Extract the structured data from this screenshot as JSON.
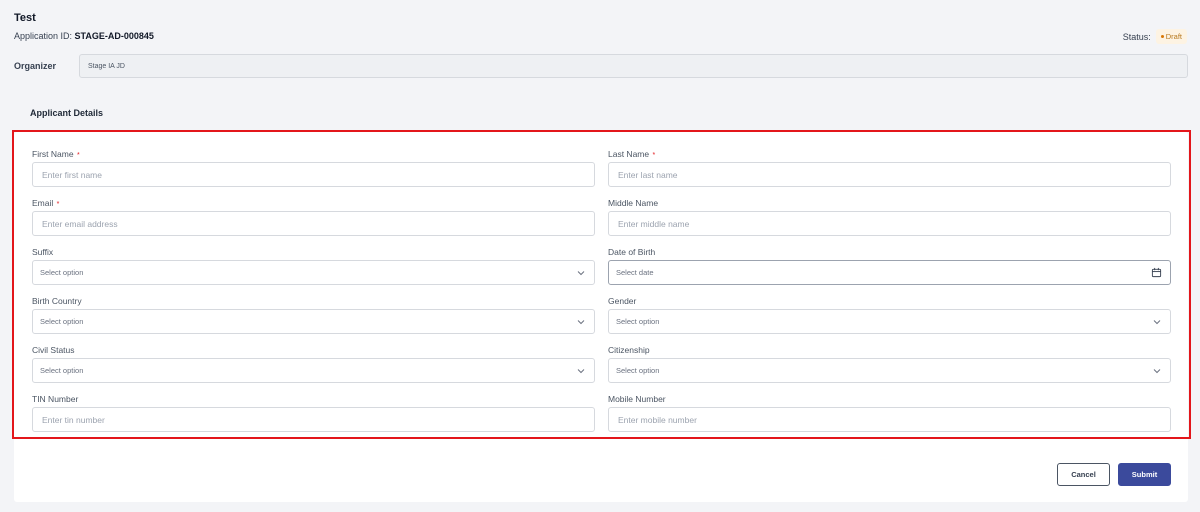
{
  "header": {
    "title": "Test",
    "app_id_label": "Application ID:",
    "app_id_value": "STAGE-AD-000845",
    "status_label": "Status:",
    "status_value": "Draft",
    "status_color": "#d97706"
  },
  "organizer": {
    "label": "Organizer",
    "value": "Stage IA JD"
  },
  "tab": {
    "label": "Applicant Details"
  },
  "form": {
    "first_name": {
      "label": "First Name",
      "required": "*",
      "placeholder": "Enter first name"
    },
    "last_name": {
      "label": "Last Name",
      "required": "*",
      "placeholder": "Enter last name"
    },
    "email": {
      "label": "Email",
      "required": "*",
      "placeholder": "Enter email address"
    },
    "middle_name": {
      "label": "Middle Name",
      "placeholder": "Enter middle name"
    },
    "suffix": {
      "label": "Suffix",
      "value": "Select option"
    },
    "dob": {
      "label": "Date of Birth",
      "value": "Select date"
    },
    "birth_country": {
      "label": "Birth Country",
      "value": "Select option"
    },
    "gender": {
      "label": "Gender",
      "value": "Select option"
    },
    "civil_status": {
      "label": "Civil Status",
      "value": "Select option"
    },
    "citizenship": {
      "label": "Citizenship",
      "value": "Select option"
    },
    "tin": {
      "label": "TIN Number",
      "placeholder": "Enter tin number"
    },
    "mobile": {
      "label": "Mobile Number",
      "placeholder": "Enter mobile number"
    }
  },
  "actions": {
    "cancel": "Cancel",
    "submit": "Submit"
  },
  "colors": {
    "accent": "#3b4a9c",
    "highlight": "#e3161b",
    "required": "#e3161b"
  },
  "icons": {
    "select": "chevron-down-icon",
    "date": "calendar-icon"
  }
}
